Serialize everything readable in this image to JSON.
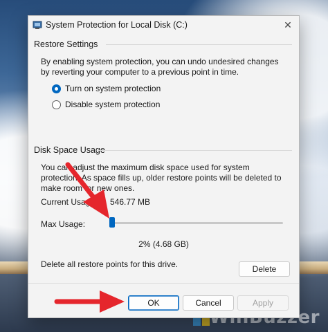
{
  "window": {
    "title": "System Protection for Local Disk (C:)",
    "close_glyph": "✕"
  },
  "restore_settings": {
    "group_title": "Restore Settings",
    "description": "By enabling system protection, you can undo undesired changes by reverting your computer to a previous point in time.",
    "options": [
      {
        "label": "Turn on system protection",
        "selected": true
      },
      {
        "label": "Disable system protection",
        "selected": false
      }
    ]
  },
  "disk_space": {
    "group_title": "Disk Space Usage",
    "description": "You can adjust the maximum disk space used for system protection. As space fills up, older restore points will be deleted to make room for new ones.",
    "current_usage_label": "Current Usage:",
    "current_usage_value": "546.77 MB",
    "max_usage_label": "Max Usage:",
    "max_usage_value": "2% (4.68 GB)",
    "slider_percent": 2,
    "delete_text": "Delete all restore points for this drive.",
    "delete_button": "Delete"
  },
  "footer": {
    "ok": "OK",
    "cancel": "Cancel",
    "apply": "Apply"
  },
  "watermark": "WinBuzzer",
  "colors": {
    "accent": "#0067c0",
    "arrow": "#e5262c",
    "dialog_bg": "#f3f3f3"
  }
}
